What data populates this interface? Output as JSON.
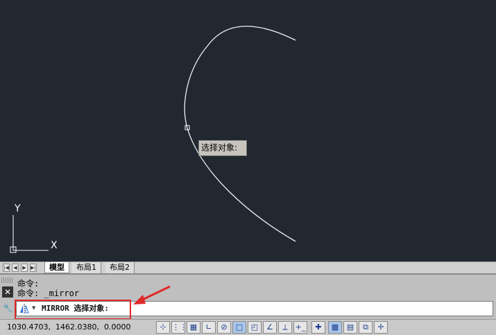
{
  "drawing": {
    "tooltip": "选择对象:",
    "ucs_x_label": "X",
    "ucs_y_label": "Y"
  },
  "layout_tabs": {
    "nav_first": "|◀",
    "nav_prev": "◀",
    "nav_next": "▶",
    "nav_last": "▶|",
    "tabs": [
      {
        "label": "模型"
      },
      {
        "label": "布局1"
      },
      {
        "label": "布局2"
      }
    ]
  },
  "command_line": {
    "history": [
      "命令:",
      "命令: _mirror"
    ],
    "current_command": "MIRROR",
    "prompt": "选择对象:",
    "close_label": "✕",
    "wrench_label": "🔧"
  },
  "status_bar": {
    "coordinates": "1030.4703,  1462.0380,  0.0000",
    "buttons": [
      {
        "icon": "infer-constraints-icon",
        "glyph": "⊹"
      },
      {
        "icon": "snap-icon",
        "glyph": "⋮⋮"
      },
      {
        "icon": "grid-icon",
        "glyph": "▦"
      },
      {
        "icon": "ortho-icon",
        "glyph": "∟"
      },
      {
        "icon": "polar-icon",
        "glyph": "⊘"
      },
      {
        "icon": "osnap-icon",
        "glyph": "□"
      },
      {
        "icon": "3d-osnap-icon",
        "glyph": "◰"
      },
      {
        "icon": "otrack-icon",
        "glyph": "∠"
      },
      {
        "icon": "ducs-icon",
        "glyph": "⟂"
      },
      {
        "icon": "dyn-icon",
        "glyph": "+_"
      },
      {
        "icon": "lineweight-icon",
        "glyph": "✚"
      },
      {
        "icon": "transparency-icon",
        "glyph": "▩"
      },
      {
        "icon": "quick-properties-icon",
        "glyph": "▤"
      },
      {
        "icon": "selection-cycling-icon",
        "glyph": "⧉"
      },
      {
        "icon": "annotation-monitor-icon",
        "glyph": "✛"
      }
    ]
  },
  "colors": {
    "canvas_bg": "#212830",
    "highlight": "#e02828"
  }
}
